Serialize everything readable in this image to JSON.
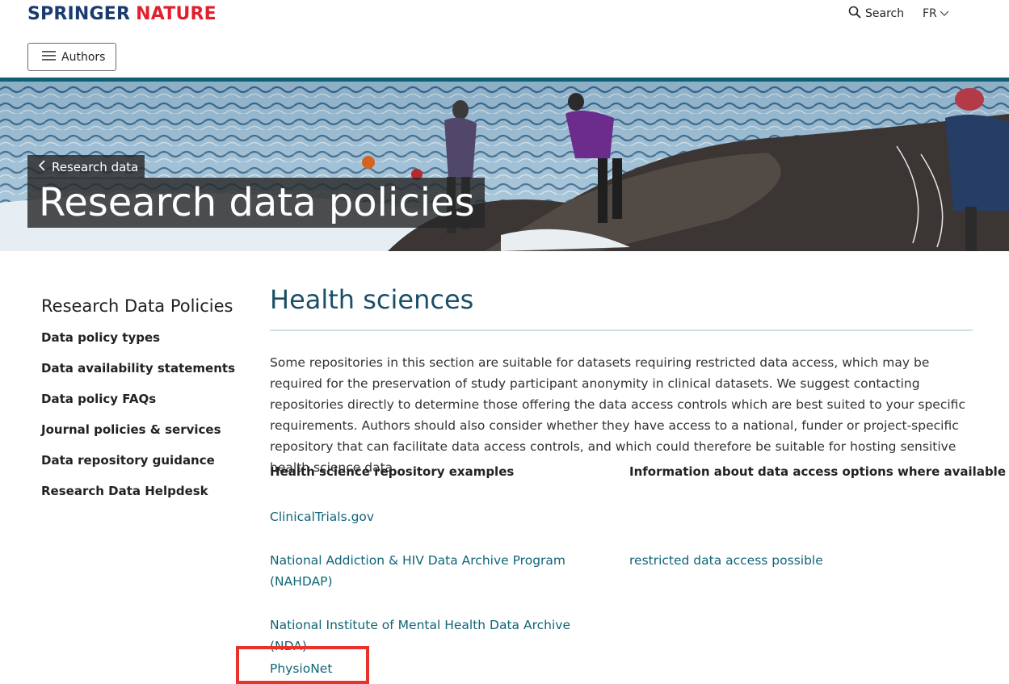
{
  "header": {
    "logo_part1": "SPRINGER",
    "logo_part2": "NATURE",
    "search_label": "Search",
    "lang_label": "FR",
    "authors_button": "Authors"
  },
  "hero": {
    "breadcrumb": "Research data",
    "title": "Research data policies"
  },
  "sidebar": {
    "heading": "Research Data Policies",
    "items": [
      "Data policy types",
      "Data availability statements",
      "Data policy FAQs",
      "Journal policies & services",
      "Data repository guidance",
      "Research Data Helpdesk"
    ]
  },
  "main": {
    "heading": "Health sciences",
    "paragraph": "Some repositories in this section are suitable for datasets requiring restricted data access, which may be required for the preservation of study participant anonymity in clinical datasets. We suggest contacting repositories directly to determine those offering the data access controls which are best suited to your specific requirements. Authors should also consider whether they have access to a national, funder or project-specific repository that can facilitate data access controls, and which could therefore be suitable for hosting sensitive health science data.",
    "col1_header": "Health science repository examples",
    "col2_header": "Information about data access options where available",
    "rows": [
      {
        "repository": "ClinicalTrials.gov",
        "access": ""
      },
      {
        "repository": "National Addiction & HIV Data Archive Program (NAHDAP)",
        "access": "restricted data access possible"
      },
      {
        "repository": "National Institute of Mental Health Data Archive (NDA)",
        "access": ""
      },
      {
        "repository": "PhysioNet",
        "access": ""
      }
    ]
  },
  "colors": {
    "brand_navy": "#1a3b6e",
    "brand_red": "#e0202e",
    "link_teal": "#0f6577",
    "heading_teal": "#1b4f66",
    "highlight_red": "#e8332a"
  }
}
